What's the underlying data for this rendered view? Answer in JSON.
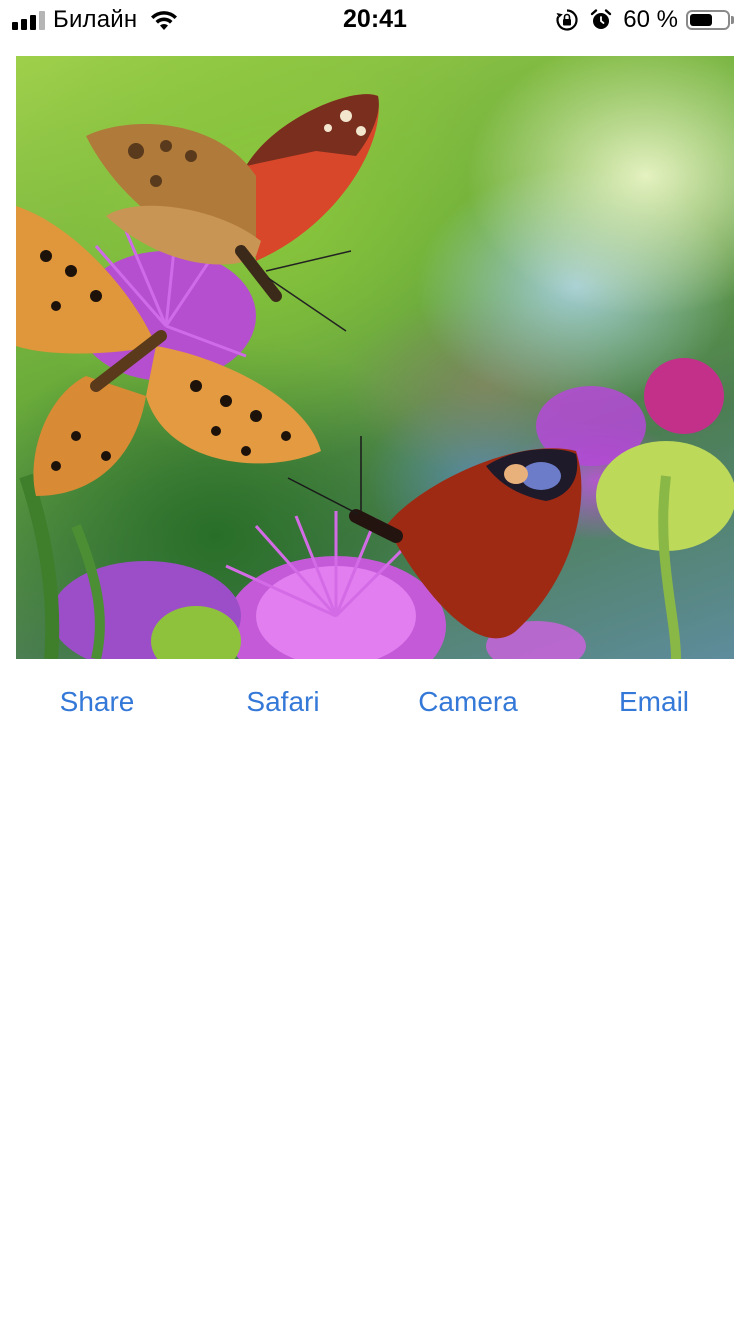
{
  "status_bar": {
    "carrier": "Билайн",
    "time": "20:41",
    "battery_percent": "60 %",
    "battery_level": 0.6,
    "icons": [
      "signal-icon",
      "wifi-icon",
      "orientation-lock-icon",
      "alarm-icon",
      "battery-icon"
    ]
  },
  "photo": {
    "subject": "butterflies-on-thistle-flowers"
  },
  "actions": {
    "share": "Share",
    "safari": "Safari",
    "camera": "Camera",
    "email": "Email"
  },
  "colors": {
    "accent": "#3478d8",
    "background": "#ffffff"
  }
}
